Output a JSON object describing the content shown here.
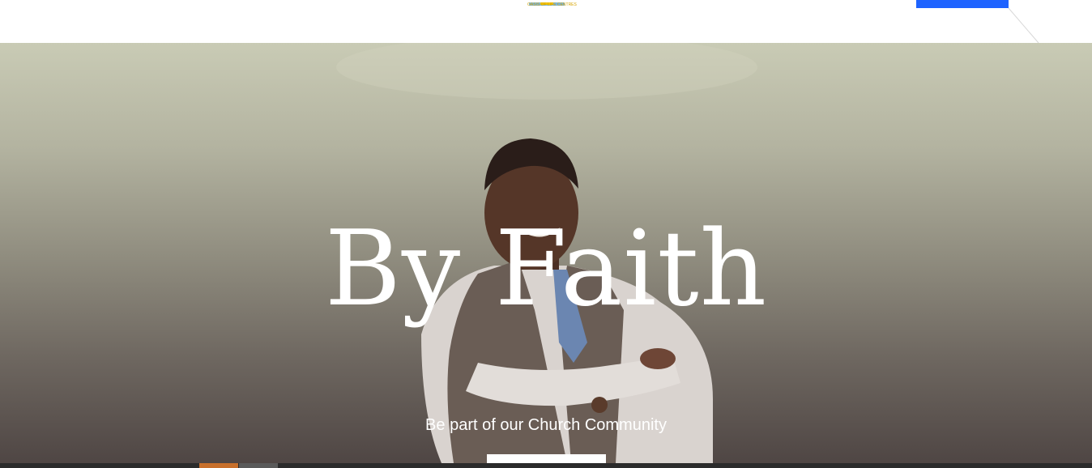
{
  "header": {
    "logo_text": "OASIS OF LIFE CENTRES",
    "cta_label": ""
  },
  "hero": {
    "title": "By Faith",
    "subtitle": "Be part of our Church Community",
    "button_label": ""
  },
  "colors": {
    "header_cta": "#1e63ff",
    "accent_tab": "#c8702c",
    "secondary_tab": "#5a5a5a",
    "logo_text": "#d6a400",
    "hero_text": "#ffffff"
  },
  "icons": {
    "logo": "church-logo-icon"
  }
}
